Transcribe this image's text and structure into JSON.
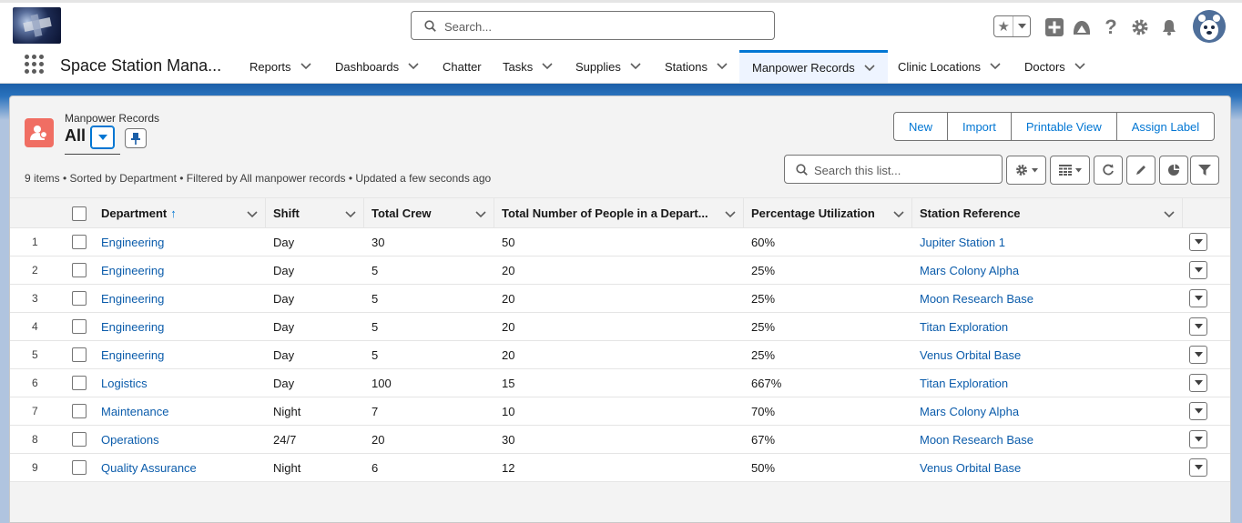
{
  "header": {
    "search_placeholder": "Search..."
  },
  "nav": {
    "app_name": "Space Station Mana...",
    "items": [
      {
        "label": "Reports"
      },
      {
        "label": "Dashboards"
      },
      {
        "label": "Chatter"
      },
      {
        "label": "Tasks"
      },
      {
        "label": "Supplies"
      },
      {
        "label": "Stations"
      },
      {
        "label": "Manpower Records"
      },
      {
        "label": "Clinic Locations"
      },
      {
        "label": "Doctors"
      }
    ],
    "active_tab": "Manpower Records"
  },
  "list": {
    "object_label": "Manpower Records",
    "view_name": "All",
    "buttons": {
      "new": "New",
      "import": "Import",
      "printable": "Printable View",
      "assign": "Assign Label"
    },
    "meta": "9 items • Sorted by Department • Filtered by All manpower records • Updated a few seconds ago",
    "search_placeholder": "Search this list...",
    "columns": [
      "Department",
      "Shift",
      "Total Crew",
      "Total Number of People in a Depart...",
      "Percentage Utilization",
      "Station Reference"
    ],
    "sort_indicator": "↑",
    "rows": [
      {
        "n": "1",
        "department": "Engineering",
        "shift": "Day",
        "crew": "30",
        "total": "50",
        "util": "60%",
        "station": "Jupiter Station 1"
      },
      {
        "n": "2",
        "department": "Engineering",
        "shift": "Day",
        "crew": "5",
        "total": "20",
        "util": "25%",
        "station": "Mars Colony Alpha"
      },
      {
        "n": "3",
        "department": "Engineering",
        "shift": "Day",
        "crew": "5",
        "total": "20",
        "util": "25%",
        "station": "Moon Research Base"
      },
      {
        "n": "4",
        "department": "Engineering",
        "shift": "Day",
        "crew": "5",
        "total": "20",
        "util": "25%",
        "station": "Titan Exploration"
      },
      {
        "n": "5",
        "department": "Engineering",
        "shift": "Day",
        "crew": "5",
        "total": "20",
        "util": "25%",
        "station": "Venus Orbital Base"
      },
      {
        "n": "6",
        "department": "Logistics",
        "shift": "Day",
        "crew": "100",
        "total": "15",
        "util": "667%",
        "station": "Titan Exploration"
      },
      {
        "n": "7",
        "department": "Maintenance",
        "shift": "Night",
        "crew": "7",
        "total": "10",
        "util": "70%",
        "station": "Mars Colony Alpha"
      },
      {
        "n": "8",
        "department": "Operations",
        "shift": "24/7",
        "crew": "20",
        "total": "30",
        "util": "67%",
        "station": "Moon Research Base"
      },
      {
        "n": "9",
        "department": "Quality Assurance",
        "shift": "Night",
        "crew": "6",
        "total": "12",
        "util": "50%",
        "station": "Venus Orbital Base"
      }
    ]
  },
  "colors": {
    "brand_blue": "#0176d3",
    "link": "#0b5cab",
    "object_icon": "#f06e63"
  }
}
